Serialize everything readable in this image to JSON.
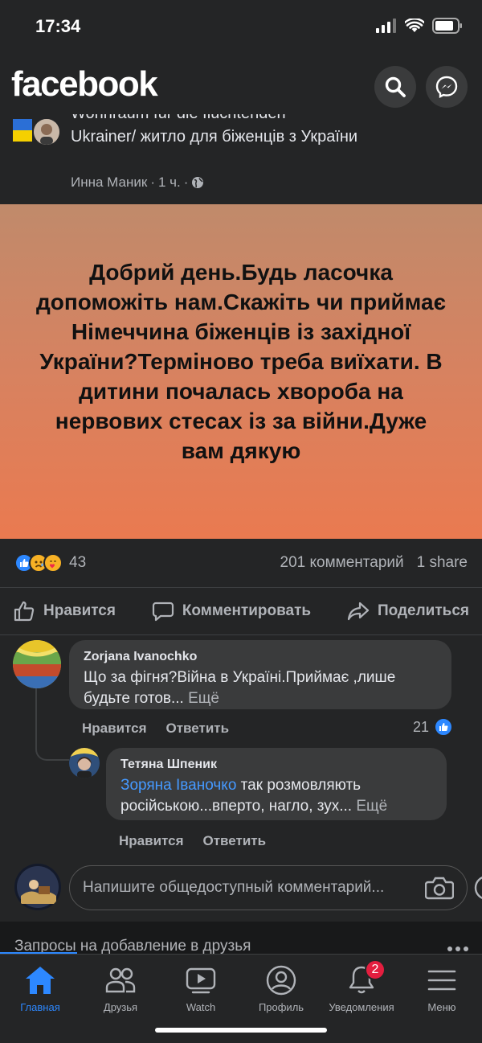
{
  "status": {
    "time": "17:34"
  },
  "header": {
    "logo": "facebook"
  },
  "post": {
    "title_cut": "Wohnraum für die flüchtenden",
    "title": "Ukrainer/ житло для біженців з України",
    "author": "Инна Маник",
    "time": "1 ч.",
    "body": "Добрий день.Будь ласочка допоможіть нам.Скажіть чи приймає Німеччина біженців із західної України?Терміново треба виїхати. В дитини почалась хвороба на нервових стесах із за війни.Дуже вам дякую",
    "reaction_count": "43",
    "comments_count": "201 комментарий",
    "shares": "1 share",
    "actions": {
      "like": "Нравится",
      "comment": "Комментировать",
      "share": "Поделиться"
    }
  },
  "comments": [
    {
      "name": "Zorjana Ivanochko",
      "text": "Що за фігня?Війна в Україні.Приймає ,лише будьте готов...",
      "more": "Ещё",
      "like": "Нравится",
      "reply": "Ответить",
      "likes": "21"
    },
    {
      "name": "Тетяна Шпеник",
      "mention": "Зоряна Іваночко",
      "text": " так розмовляють російською...вперто, нагло, зух...",
      "more": "Ещё",
      "like": "Нравится",
      "reply": "Ответить"
    }
  ],
  "composer": {
    "placeholder": "Напишите общедоступный комментарий..."
  },
  "next_section": {
    "title": "Запросы на добавление в друзья"
  },
  "tabs": [
    {
      "label": "Главная",
      "icon": "home-icon"
    },
    {
      "label": "Друзья",
      "icon": "friends-icon"
    },
    {
      "label": "Watch",
      "icon": "watch-icon"
    },
    {
      "label": "Профиль",
      "icon": "profile-icon"
    },
    {
      "label": "Уведомления",
      "icon": "bell-icon",
      "badge": "2"
    },
    {
      "label": "Меню",
      "icon": "menu-icon"
    }
  ],
  "colors": {
    "accent": "#2d88ff",
    "badge": "#e41e3f",
    "background": "#18191a",
    "surface": "#242526"
  }
}
